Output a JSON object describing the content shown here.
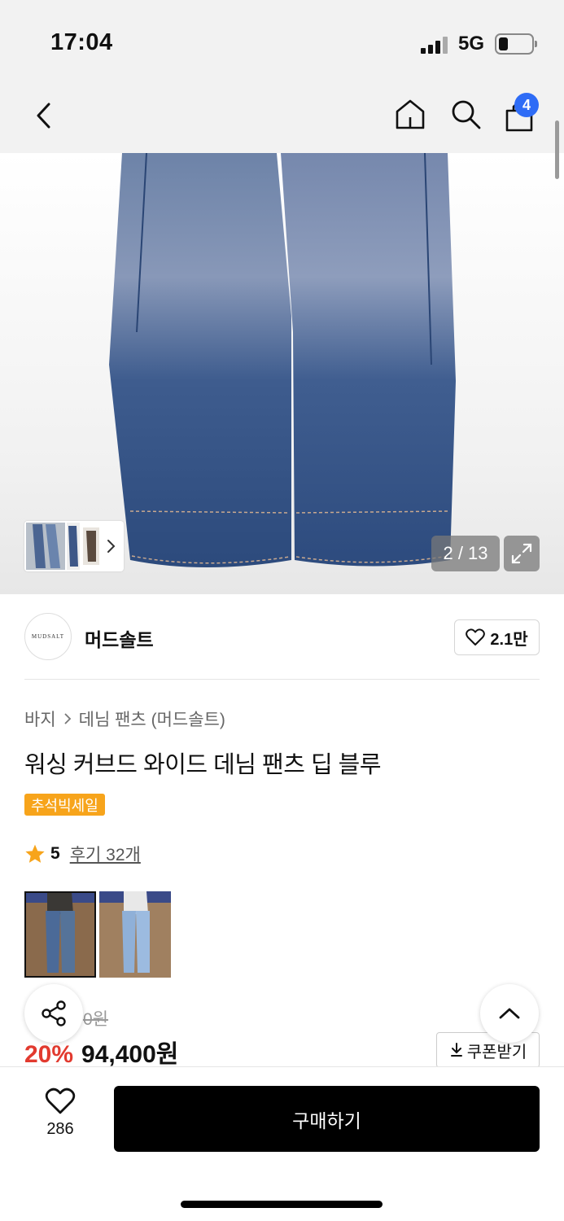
{
  "status_bar": {
    "time": "17:04",
    "network": "5G"
  },
  "nav": {
    "back_icon": "chevron-left-icon",
    "home_icon": "home-icon",
    "search_icon": "search-icon",
    "cart_icon": "shopping-bag-icon",
    "cart_count": "4"
  },
  "gallery": {
    "counter": "2 / 13",
    "thumb_arrow": "›",
    "expand_icon": "expand-icon"
  },
  "brand": {
    "logo_text": "MUDSALT",
    "name": "머드솔트",
    "likes": "2.1만"
  },
  "product": {
    "breadcrumb": {
      "category": "바지",
      "subcategory": "데님 팬츠 (머드솔트)"
    },
    "title": "워싱 커브드 와이드 데님 팬츠 딥 블루",
    "sale_tag": "추석빅세일",
    "rating": {
      "score": "5",
      "reviews": "후기 32개"
    },
    "original_price": "0원",
    "discount": "20%",
    "price": "94,400원",
    "coupon_label": "쿠폰받기"
  },
  "bottom": {
    "wish_count": "286",
    "buy_label": "구매하기"
  },
  "colors": {
    "accent_blue": "#2e6cf6",
    "sale_orange": "#f7a41b",
    "discount_red": "#e23a2f",
    "denim_dark": "#2d4a78"
  }
}
